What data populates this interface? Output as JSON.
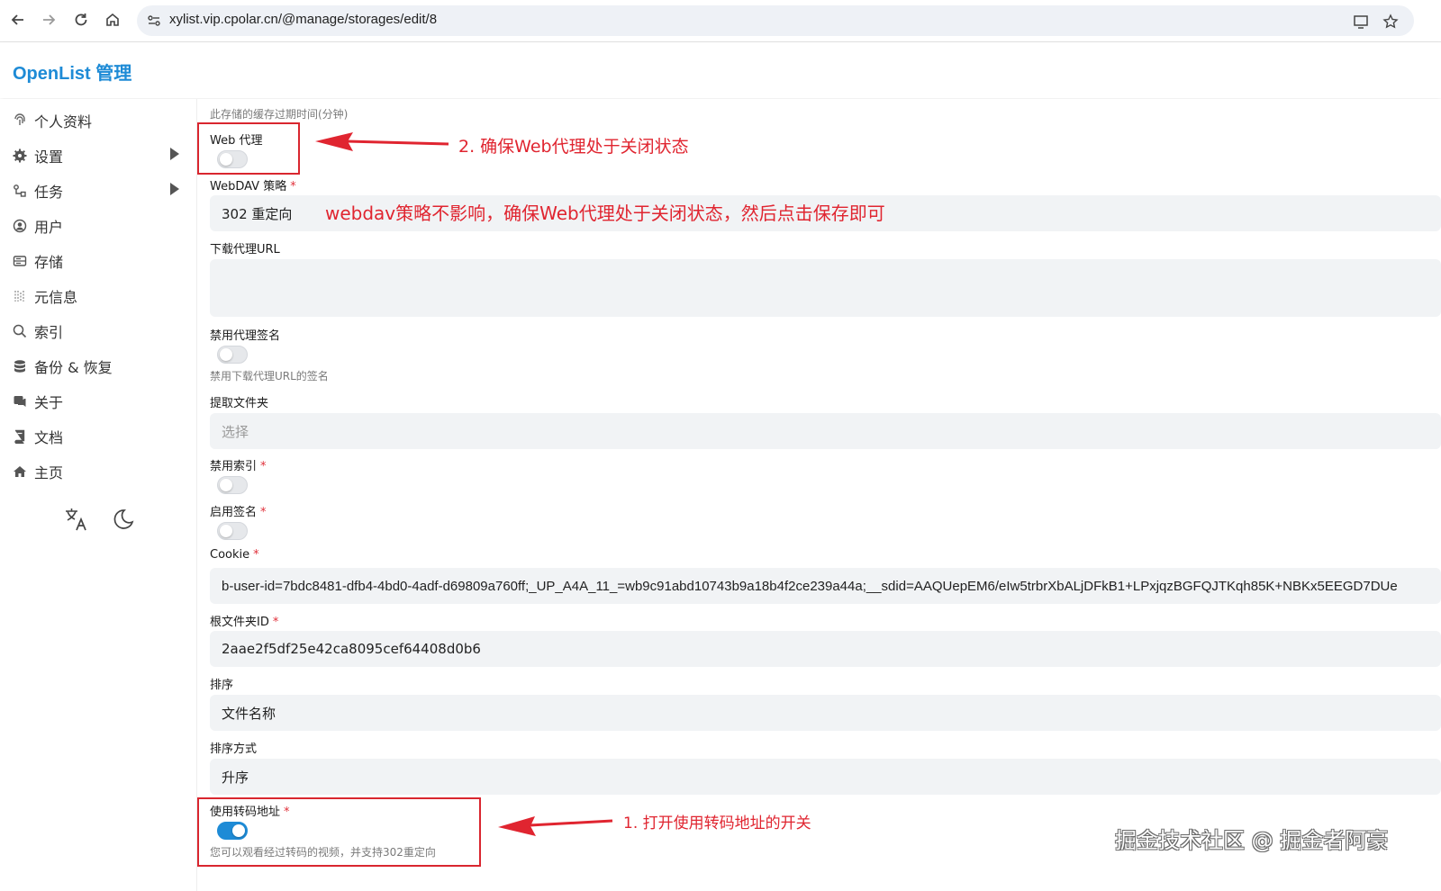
{
  "browser": {
    "url": "xylist.vip.cpolar.cn/@manage/storages/edit/8",
    "back_icon": "arrow-left-icon",
    "forward_icon": "arrow-right-icon",
    "reload_icon": "reload-icon",
    "home_icon": "home-icon"
  },
  "app": {
    "title": "OpenList 管理"
  },
  "sidebar": {
    "items": [
      {
        "label": "个人资料",
        "icon": "fingerprint-icon"
      },
      {
        "label": "设置",
        "icon": "gear-icon"
      },
      {
        "label": "任务",
        "icon": "task-icon"
      },
      {
        "label": "用户",
        "icon": "user-icon"
      },
      {
        "label": "存储",
        "icon": "storage-icon"
      },
      {
        "label": "元信息",
        "icon": "meta-icon"
      },
      {
        "label": "索引",
        "icon": "search-icon"
      },
      {
        "label": "备份 & 恢复",
        "icon": "database-icon"
      },
      {
        "label": "关于",
        "icon": "chat-icon"
      },
      {
        "label": "文档",
        "icon": "book-icon"
      },
      {
        "label": "主页",
        "icon": "house-icon"
      }
    ]
  },
  "form": {
    "cache_help": "此存储的缓存过期时间(分钟)",
    "web_proxy_label": "Web 代理",
    "webdav_policy_label": "WebDAV 策略",
    "webdav_policy_value": "302 重定向",
    "download_proxy_url_label": "下载代理URL",
    "disable_proxy_sign_label": "禁用代理签名",
    "disable_proxy_sign_help": "禁用下载代理URL的签名",
    "extract_folder_label": "提取文件夹",
    "extract_folder_placeholder": "选择",
    "disable_index_label": "禁用索引",
    "enable_sign_label": "启用签名",
    "cookie_label": "Cookie",
    "cookie_value": "b-user-id=7bdc8481-dfb4-4bd0-4adf-d69809a760ff;_UP_A4A_11_=wb9c91abd10743b9a18b4f2ce239a44a;__sdid=AAQUepEM6/eIw5trbrXbALjDFkB1+LPxjqzBGFQJTKqh85K+NBKx5EEGD7DUe",
    "root_folder_label": "根文件夹ID",
    "root_folder_value": "2aae2f5df25e42ca8095cef64408d0b6",
    "order_by_label": "排序",
    "order_by_value": "文件名称",
    "order_dir_label": "排序方式",
    "order_dir_value": "升序",
    "transcode_label": "使用转码地址",
    "transcode_help": "您可以观看经过转码的视频，并支持302重定向",
    "required_mark": "*"
  },
  "annotations": {
    "step2": "2. 确保Web代理处于关闭状态",
    "note": "webdav策略不影响，确保Web代理处于关闭状态，然后点击保存即可",
    "step1": "1. 打开使用转码地址的开关"
  },
  "watermark": "掘金技术社区 @ 掘金者阿豪",
  "colors": {
    "brand": "#1e8bd6",
    "annotation": "#e02530"
  }
}
